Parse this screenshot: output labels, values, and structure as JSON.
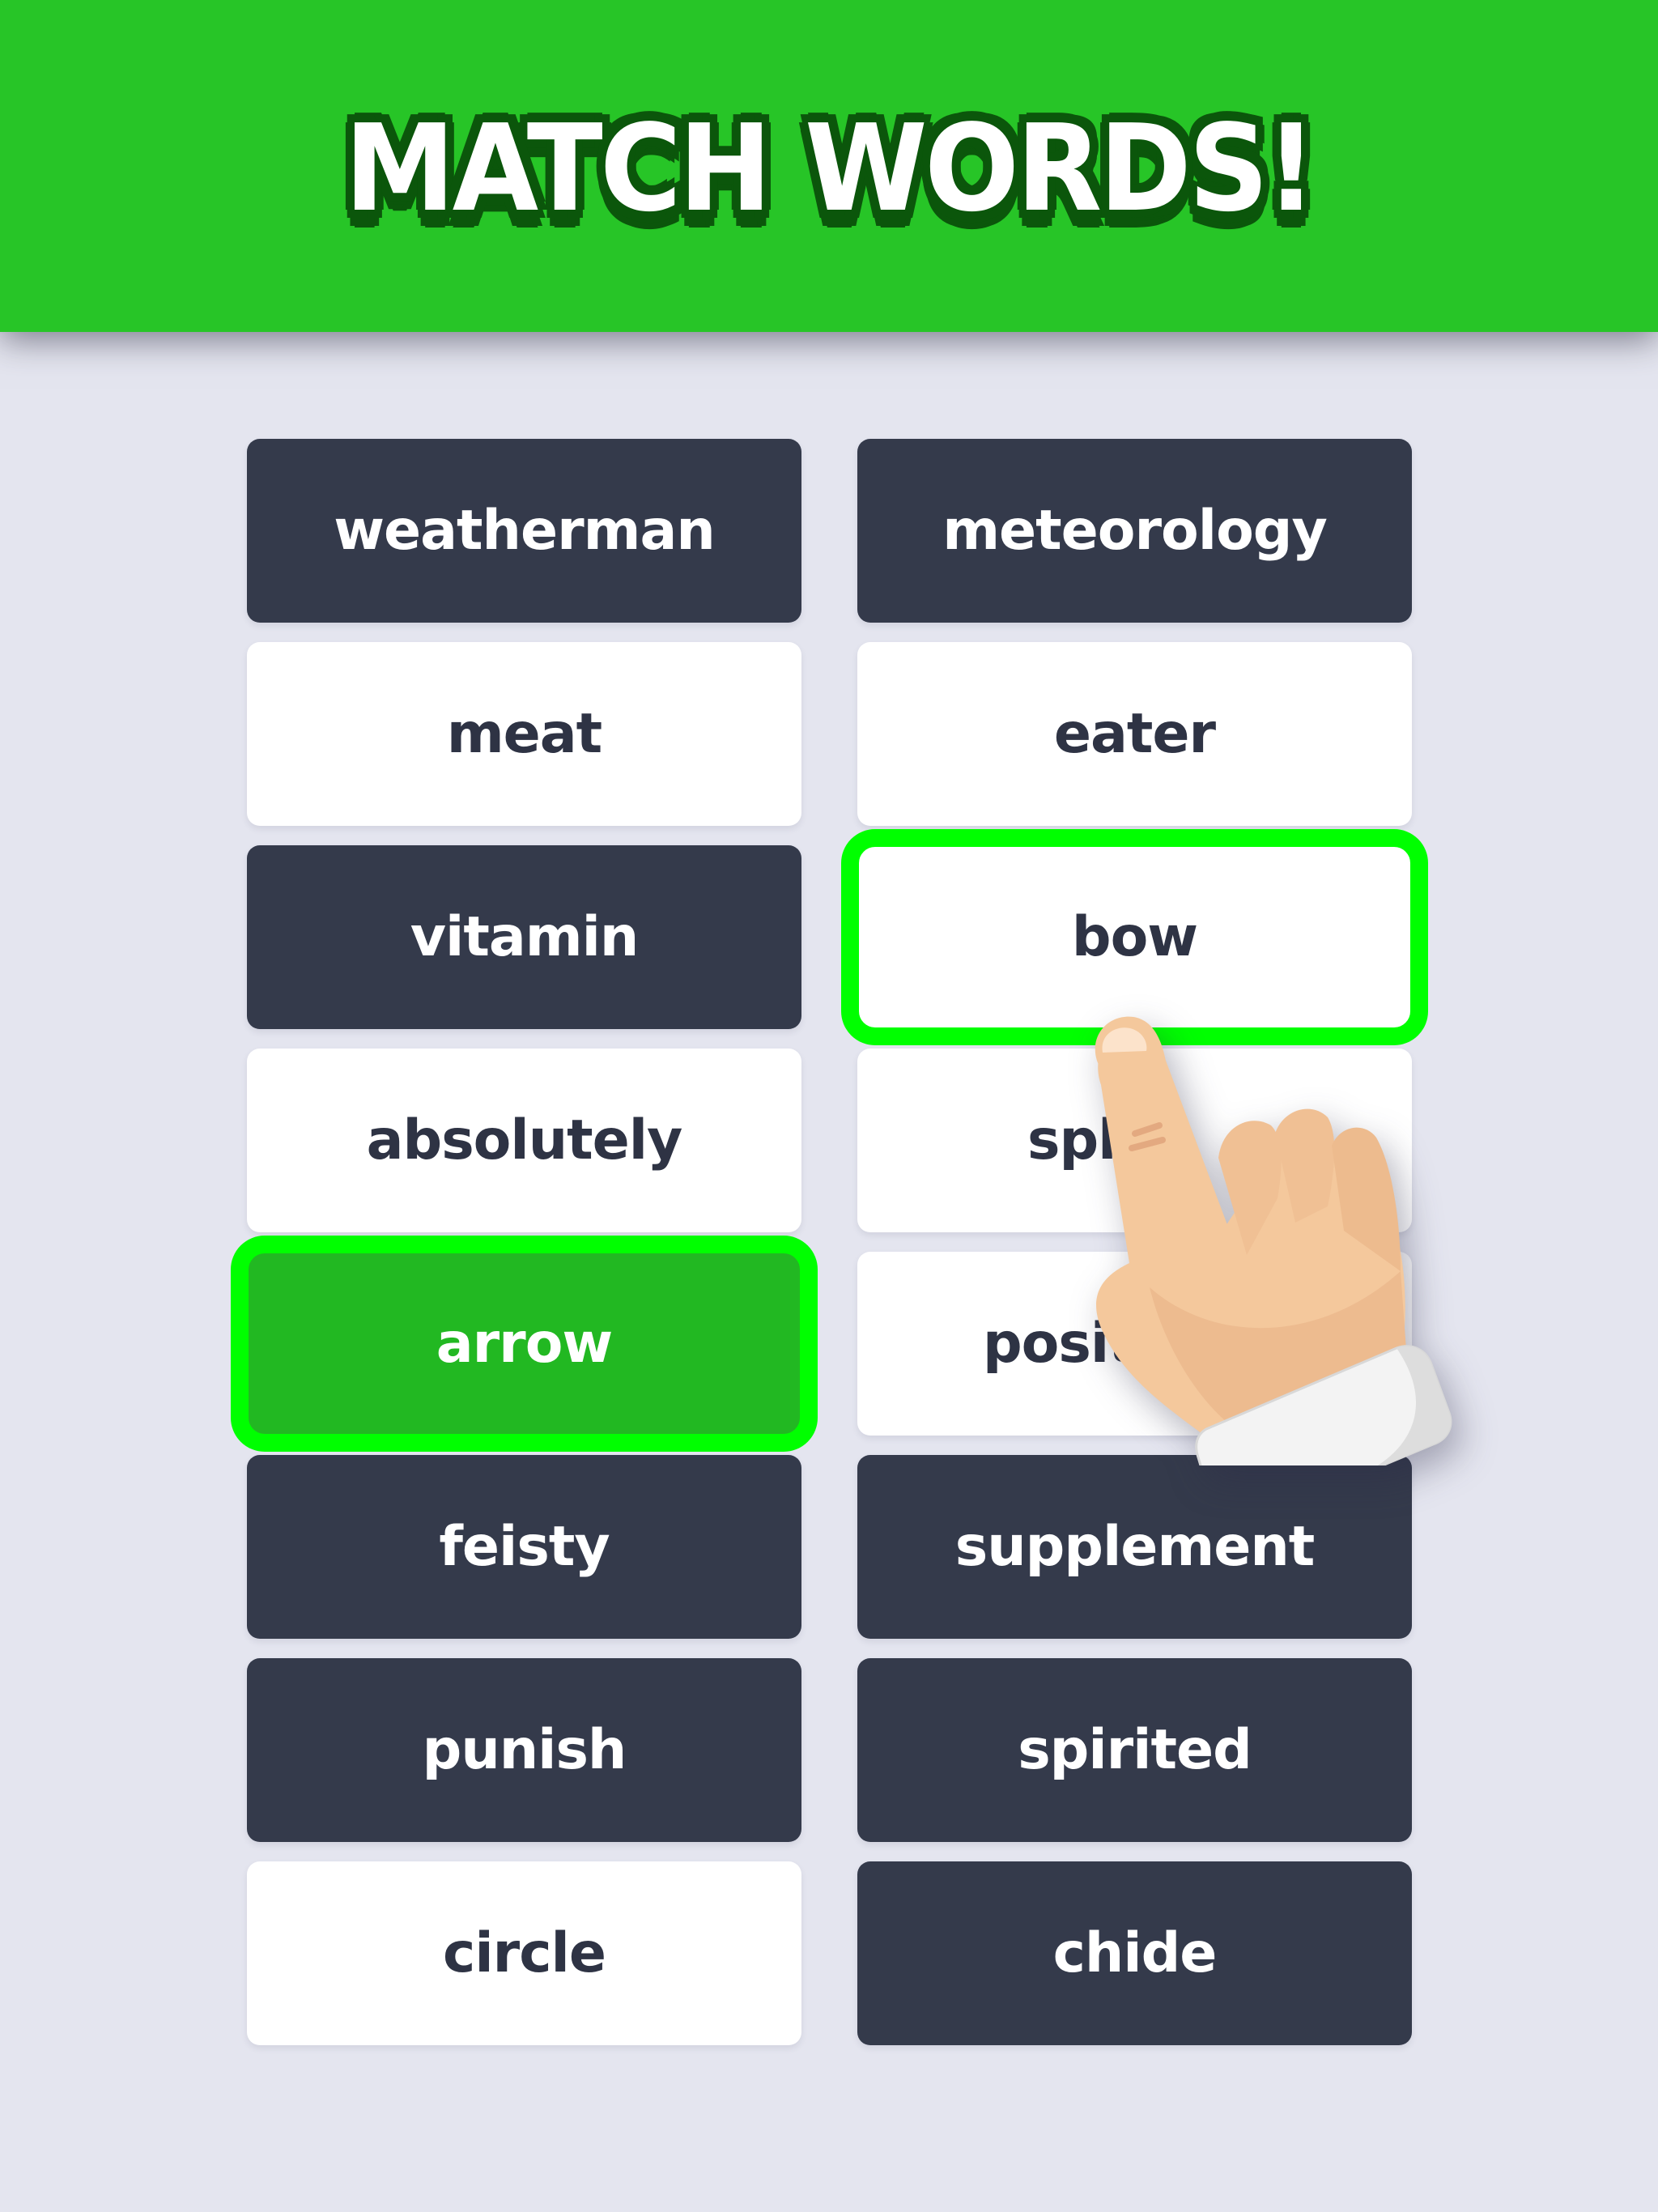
{
  "header": {
    "title": "MATCH WORDS!",
    "background_color": "#27C527",
    "title_outline_color": "#0B560B"
  },
  "colors": {
    "background": "#E4E5EF",
    "card_dark": "#343A4B",
    "card_light": "#FFFFFF",
    "card_selected_fill": "#22B822",
    "selection_outline": "#00FF00",
    "text_dark": "#2E3344"
  },
  "cards": {
    "left": [
      {
        "word": "weatherman",
        "state": "dark"
      },
      {
        "word": "meat",
        "state": "light"
      },
      {
        "word": "vitamin",
        "state": "dark"
      },
      {
        "word": "absolutely",
        "state": "light"
      },
      {
        "word": "arrow",
        "state": "selected-green"
      },
      {
        "word": "feisty",
        "state": "dark"
      },
      {
        "word": "punish",
        "state": "dark"
      },
      {
        "word": "circle",
        "state": "light"
      }
    ],
    "right": [
      {
        "word": "meteorology",
        "state": "dark"
      },
      {
        "word": "eater",
        "state": "light"
      },
      {
        "word": "bow",
        "state": "selected-light"
      },
      {
        "word": "sph",
        "state": "light"
      },
      {
        "word": "positive",
        "state": "light"
      },
      {
        "word": "supplement",
        "state": "dark"
      },
      {
        "word": "spirited",
        "state": "dark"
      },
      {
        "word": "chide",
        "state": "dark"
      }
    ]
  },
  "pointer": {
    "icon": "pointing-hand-icon",
    "target_word": "bow"
  }
}
